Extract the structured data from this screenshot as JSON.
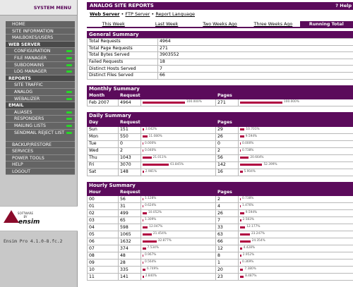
{
  "sidebar": {
    "header": "SYSTEM MENU",
    "items": [
      {
        "label": "HOME",
        "type": "item",
        "led": false
      },
      {
        "label": "SITE INFORMATION",
        "type": "item",
        "led": false
      },
      {
        "label": "MAILBOXES/USERS",
        "type": "item",
        "led": false
      },
      {
        "label": "WEB SERVER",
        "type": "section",
        "led": false
      },
      {
        "label": "CONFIGURATION",
        "type": "sub",
        "led": true
      },
      {
        "label": "FILE MANAGER",
        "type": "sub",
        "led": true
      },
      {
        "label": "SUBDOMAINS",
        "type": "sub",
        "led": true
      },
      {
        "label": "LOG MANAGER",
        "type": "sub",
        "led": true
      },
      {
        "label": "REPORTS",
        "type": "section",
        "led": false
      },
      {
        "label": "SITE TRAFFIC",
        "type": "sub",
        "led": false
      },
      {
        "label": "ANALOG",
        "type": "sub",
        "led": true
      },
      {
        "label": "WEBALIZER",
        "type": "sub",
        "led": true
      },
      {
        "label": "EMAIL",
        "type": "section",
        "led": false
      },
      {
        "label": "ALIASES",
        "type": "sub",
        "led": true
      },
      {
        "label": "RESPONDERS",
        "type": "sub",
        "led": true
      },
      {
        "label": "MAILING LISTS",
        "type": "sub",
        "led": true
      },
      {
        "label": "SENDMAIL REJECT LIST",
        "type": "subtall",
        "led": true
      },
      {
        "label": "BACKUP/RESTORE",
        "type": "item",
        "led": false
      },
      {
        "label": "SERVICES",
        "type": "item",
        "led": false
      },
      {
        "label": "POWER TOOLS",
        "type": "item",
        "led": false
      },
      {
        "label": "HELP",
        "type": "item",
        "led": false
      },
      {
        "label": "LOGOUT",
        "type": "item",
        "led": false
      }
    ],
    "logo_small": "SOFTWARE BY",
    "logo_brand": "ensim",
    "version": "Ensim Pro 4.1.0-8.fc.2"
  },
  "header": {
    "title": "ANALOG SITE REPORTS",
    "help": "? Help",
    "link_active": "Web Server",
    "link_ftp": "FTP Server",
    "link_lang": "Report Language",
    "sep": "•"
  },
  "tabs": [
    "This Week",
    "Last Week",
    "Two Weeks Ago",
    "Three Weeks Ago",
    "Running Total"
  ],
  "general": {
    "title": "General Summary",
    "rows": [
      [
        "Total Requests",
        "4964"
      ],
      [
        "Total Page Requests",
        "271"
      ],
      [
        "Total Bytes Served",
        "3903552"
      ],
      [
        "Failed Requests",
        "18"
      ],
      [
        "Distinct Hosts Served",
        "7"
      ],
      [
        "Distinct Files Served",
        "66"
      ]
    ]
  },
  "monthly": {
    "title": "Monthly Summary",
    "cols": [
      "Month",
      "Requests",
      "",
      "Pages",
      ""
    ],
    "rows": [
      {
        "label": "Feb 2007",
        "req": "4964",
        "req_pct": "100.000%",
        "req_frac": 1.0,
        "pages": "271",
        "pages_pct": "100.000%",
        "pages_frac": 1.0
      }
    ]
  },
  "daily": {
    "title": "Daily Summary",
    "cols": [
      "Day",
      "Requests",
      "",
      "Pages",
      ""
    ],
    "rows": [
      {
        "label": "Sun",
        "req": "151",
        "req_pct": "3.042%",
        "req_frac": 0.03042,
        "pages": "29",
        "pages_pct": "10.701%",
        "pages_frac": 0.10701
      },
      {
        "label": "Mon",
        "req": "550",
        "req_pct": "11.080%",
        "req_frac": 0.1108,
        "pages": "26",
        "pages_pct": "9.594%",
        "pages_frac": 0.09594
      },
      {
        "label": "Tue",
        "req": "0",
        "req_pct": "0.000%",
        "req_frac": 0,
        "pages": "0",
        "pages_pct": "0.000%",
        "pages_frac": 0
      },
      {
        "label": "Wed",
        "req": "2",
        "req_pct": "0.040%",
        "req_frac": 0.0004,
        "pages": "2",
        "pages_pct": "0.738%",
        "pages_frac": 0.00738
      },
      {
        "label": "Thu",
        "req": "1043",
        "req_pct": "21.011%",
        "req_frac": 0.21011,
        "pages": "56",
        "pages_pct": "20.664%",
        "pages_frac": 0.20664
      },
      {
        "label": "Fri",
        "req": "3070",
        "req_pct": "61.845%",
        "req_frac": 0.61845,
        "pages": "142",
        "pages_pct": "52.399%",
        "pages_frac": 0.52399
      },
      {
        "label": "Sat",
        "req": "148",
        "req_pct": "2.981%",
        "req_frac": 0.02981,
        "pages": "16",
        "pages_pct": "5.904%",
        "pages_frac": 0.05904
      }
    ]
  },
  "hourly": {
    "title": "Hourly Summary",
    "cols": [
      "Hour",
      "Requests",
      "",
      "Pages",
      ""
    ],
    "rows": [
      {
        "label": "00",
        "req": "56",
        "req_pct": "1.128%",
        "req_frac": 0.01128,
        "pages": "2",
        "pages_pct": "0.738%",
        "pages_frac": 0.00738
      },
      {
        "label": "01",
        "req": "31",
        "req_pct": "0.624%",
        "req_frac": 0.00624,
        "pages": "4",
        "pages_pct": "1.476%",
        "pages_frac": 0.01476
      },
      {
        "label": "02",
        "req": "499",
        "req_pct": "10.052%",
        "req_frac": 0.10052,
        "pages": "26",
        "pages_pct": "9.594%",
        "pages_frac": 0.09594
      },
      {
        "label": "03",
        "req": "65",
        "req_pct": "1.309%",
        "req_frac": 0.01309,
        "pages": "7",
        "pages_pct": "2.583%",
        "pages_frac": 0.02583
      },
      {
        "label": "04",
        "req": "598",
        "req_pct": "12.047%",
        "req_frac": 0.12047,
        "pages": "33",
        "pages_pct": "12.177%",
        "pages_frac": 0.12177
      },
      {
        "label": "05",
        "req": "1065",
        "req_pct": "21.454%",
        "req_frac": 0.21454,
        "pages": "63",
        "pages_pct": "23.247%",
        "pages_frac": 0.23247
      },
      {
        "label": "06",
        "req": "1632",
        "req_pct": "32.877%",
        "req_frac": 0.32877,
        "pages": "66",
        "pages_pct": "24.354%",
        "pages_frac": 0.24354
      },
      {
        "label": "07",
        "req": "374",
        "req_pct": "7.534%",
        "req_frac": 0.07534,
        "pages": "12",
        "pages_pct": "4.428%",
        "pages_frac": 0.04428
      },
      {
        "label": "08",
        "req": "48",
        "req_pct": "0.967%",
        "req_frac": 0.00967,
        "pages": "8",
        "pages_pct": "2.952%",
        "pages_frac": 0.02952
      },
      {
        "label": "09",
        "req": "28",
        "req_pct": "0.564%",
        "req_frac": 0.00564,
        "pages": "1",
        "pages_pct": "0.369%",
        "pages_frac": 0.00369
      },
      {
        "label": "10",
        "req": "335",
        "req_pct": "6.749%",
        "req_frac": 0.06749,
        "pages": "20",
        "pages_pct": "7.380%",
        "pages_frac": 0.0738
      },
      {
        "label": "11",
        "req": "141",
        "req_pct": "2.840%",
        "req_frac": 0.0284,
        "pages": "23",
        "pages_pct": "8.487%",
        "pages_frac": 0.08487
      }
    ]
  }
}
